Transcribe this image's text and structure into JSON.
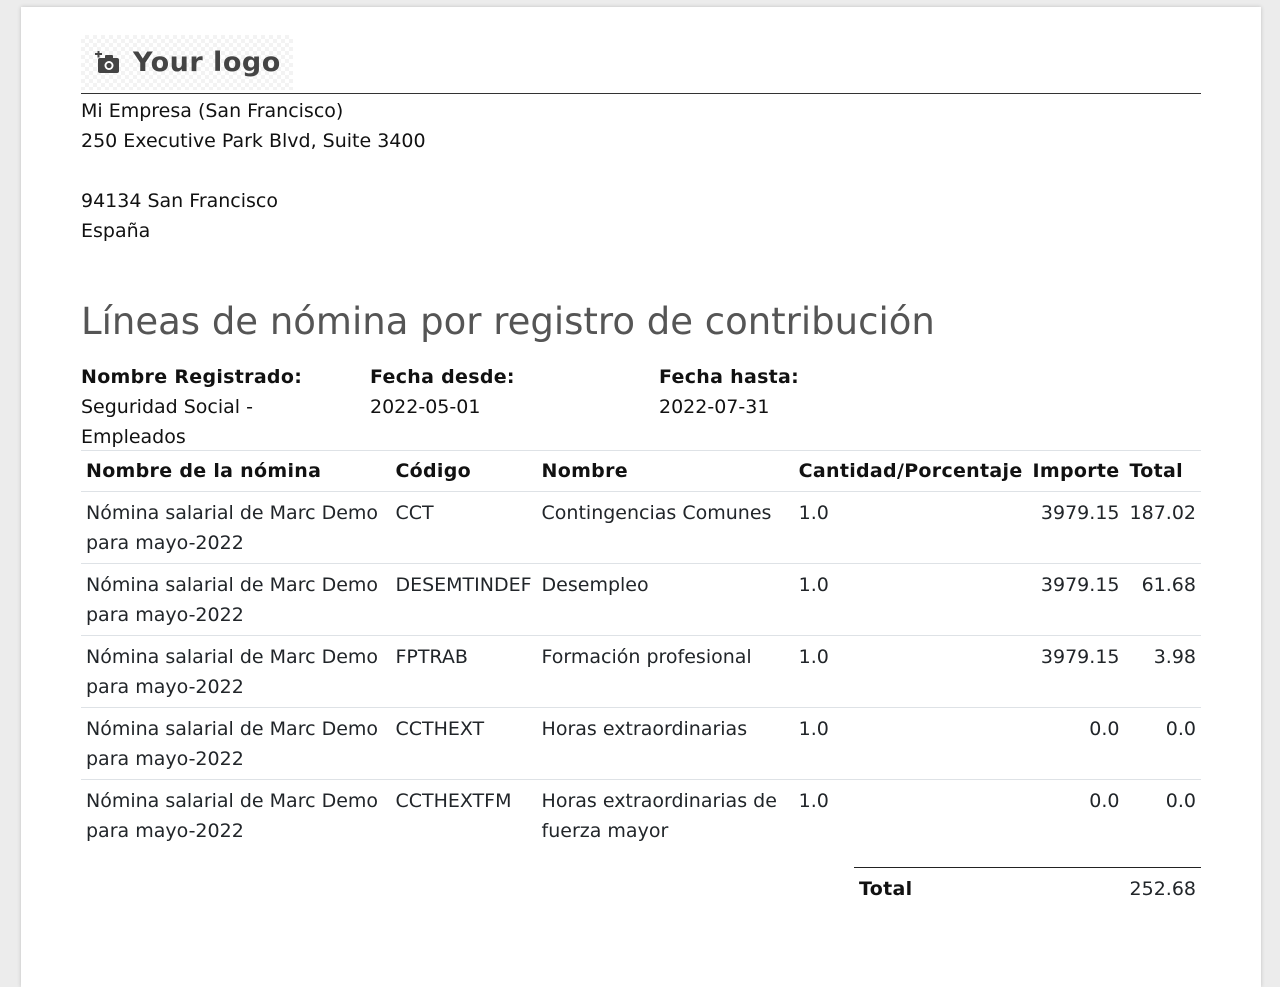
{
  "logo": {
    "text": "Your logo",
    "icon": "camera-plus-icon"
  },
  "company": {
    "name": "Mi Empresa (San Francisco)",
    "street": "250 Executive Park Blvd, Suite 3400",
    "street2": "",
    "city_line": "94134 San Francisco",
    "country": "España"
  },
  "report": {
    "title": "Líneas de nómina por registro de contribución",
    "registered_name_label": "Nombre Registrado:",
    "registered_name_value": "Seguridad Social - Empleados",
    "date_from_label": "Fecha desde:",
    "date_from_value": "2022-05-01",
    "date_to_label": "Fecha hasta:",
    "date_to_value": "2022-07-31"
  },
  "table": {
    "headers": {
      "payslip": "Nombre de la nómina",
      "code": "Código",
      "name": "Nombre",
      "quantity": "Cantidad/Porcentaje",
      "amount": "Importe",
      "total": "Total"
    },
    "rows": [
      {
        "payslip": "Nómina salarial de Marc Demo para mayo-2022",
        "code": "CCT",
        "name": "Contingencias Comunes",
        "quantity": "1.0",
        "amount": "3979.15",
        "total": "187.02"
      },
      {
        "payslip": "Nómina salarial de Marc Demo para mayo-2022",
        "code": "DESEMTINDEF",
        "name": "Desempleo",
        "quantity": "1.0",
        "amount": "3979.15",
        "total": "61.68"
      },
      {
        "payslip": "Nómina salarial de Marc Demo para mayo-2022",
        "code": "FPTRAB",
        "name": "Formación profesional",
        "quantity": "1.0",
        "amount": "3979.15",
        "total": "3.98"
      },
      {
        "payslip": "Nómina salarial de Marc Demo para mayo-2022",
        "code": "CCTHEXT",
        "name": "Horas extraordinarias",
        "quantity": "1.0",
        "amount": "0.0",
        "total": "0.0"
      },
      {
        "payslip": "Nómina salarial de Marc Demo para mayo-2022",
        "code": "CCTHEXTFM",
        "name": "Horas extraordinarias de fuerza mayor",
        "quantity": "1.0",
        "amount": "0.0",
        "total": "0.0"
      }
    ]
  },
  "totals": {
    "label": "Total",
    "value": "252.68"
  }
}
